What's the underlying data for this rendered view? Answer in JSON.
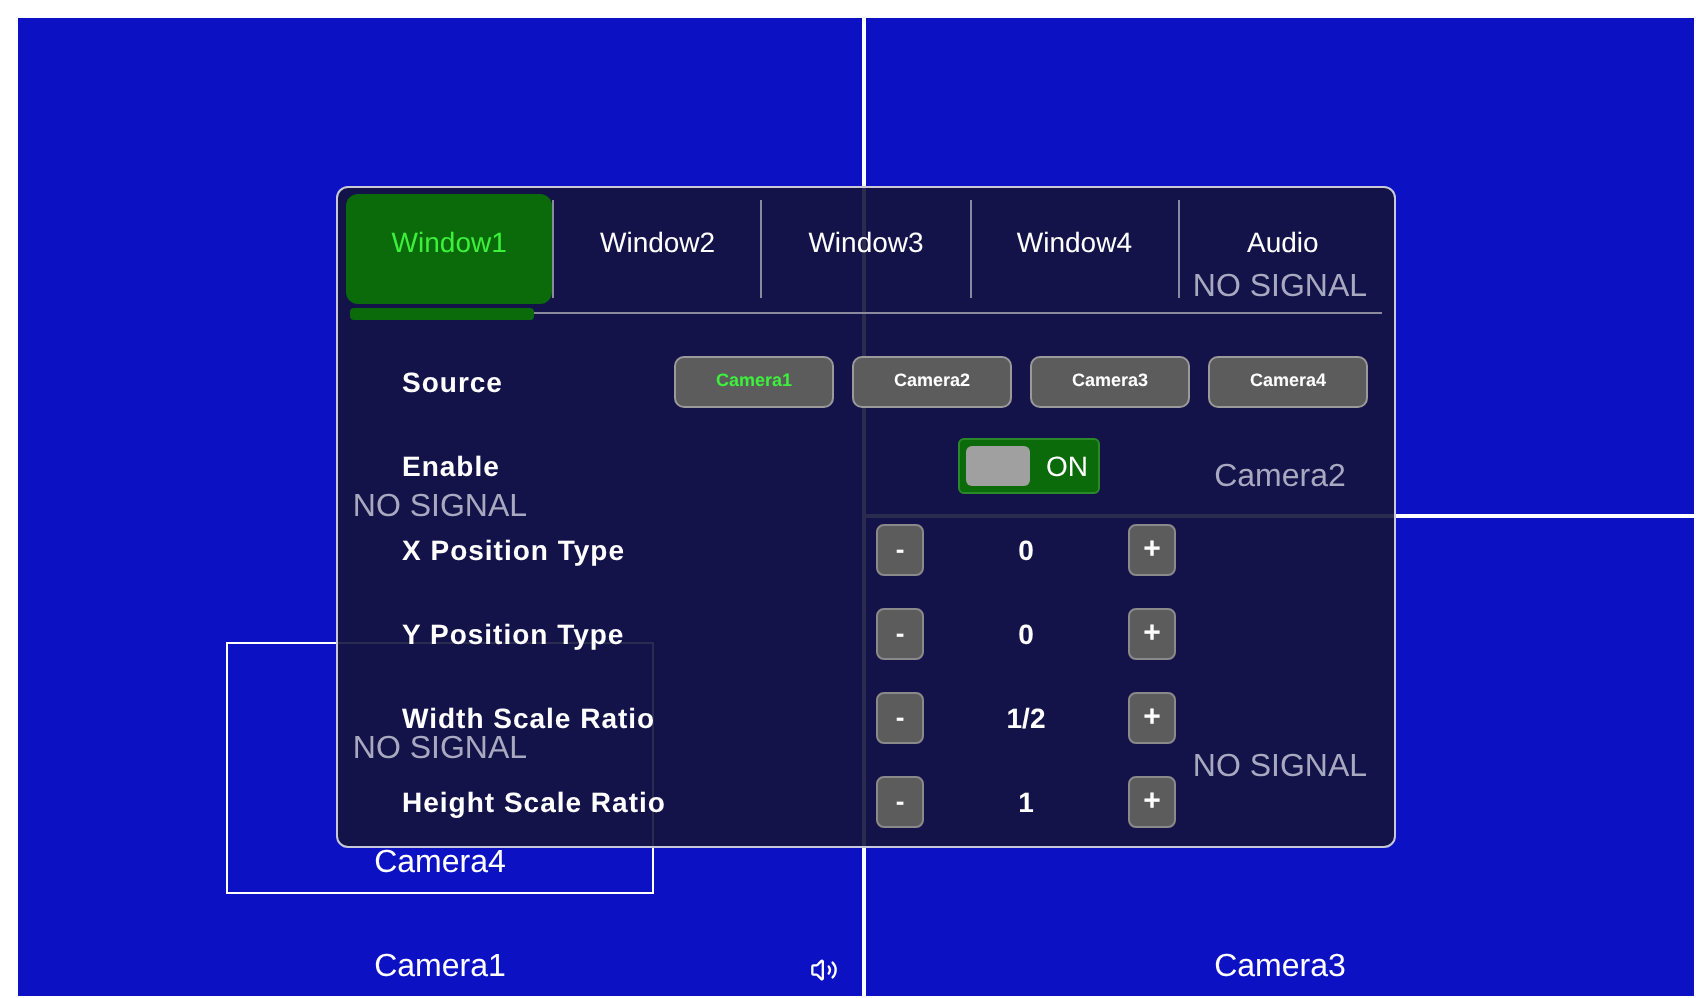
{
  "video_wall": {
    "tiles": [
      {
        "camera": "Camera1",
        "signal": "NO SIGNAL",
        "audio": true
      },
      {
        "camera": "Camera4",
        "signal": "NO SIGNAL",
        "audio": false
      },
      {
        "camera": "Camera2",
        "signal": "NO SIGNAL",
        "audio": false
      },
      {
        "camera": "Camera3",
        "signal": "NO SIGNAL",
        "audio": false
      }
    ]
  },
  "tabs": [
    {
      "label": "Window1",
      "selected": true
    },
    {
      "label": "Window2",
      "selected": false
    },
    {
      "label": "Window3",
      "selected": false
    },
    {
      "label": "Window4",
      "selected": false
    },
    {
      "label": "Audio",
      "selected": false
    }
  ],
  "source": {
    "label": "Source",
    "options": [
      {
        "label": "Camera1",
        "selected": true
      },
      {
        "label": "Camera2",
        "selected": false
      },
      {
        "label": "Camera3",
        "selected": false
      },
      {
        "label": "Camera4",
        "selected": false
      }
    ]
  },
  "enable": {
    "label": "Enable",
    "on": true,
    "state_text": "ON"
  },
  "steppers": [
    {
      "label": "X Position Type",
      "value": "0",
      "minus": "-",
      "plus": "+"
    },
    {
      "label": "Y Position Type",
      "value": "0",
      "minus": "-",
      "plus": "+"
    },
    {
      "label": "Width Scale Ratio",
      "value": "1/2",
      "minus": "-",
      "plus": "+"
    },
    {
      "label": "Height Scale Ratio",
      "value": "1",
      "minus": "-",
      "plus": "+"
    }
  ]
}
